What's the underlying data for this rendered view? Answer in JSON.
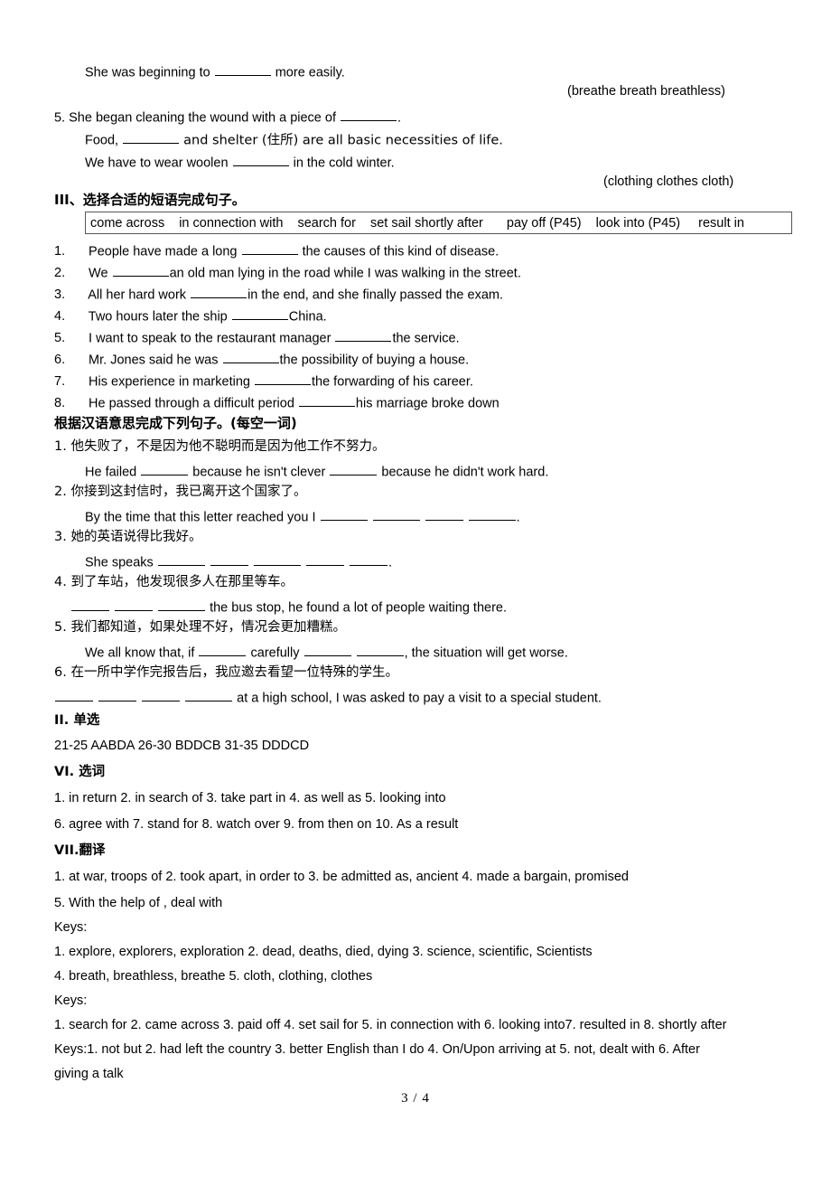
{
  "document": {
    "footer_page": "3 / 4"
  },
  "top_section": {
    "line_breathe_sentence": "She was beginning to",
    "line_breathe_tail": "more easily.",
    "word_hint_breathe": "(breathe     breath     breathless)",
    "item5_number": "5.",
    "item5_text_a": "She began cleaning the wound with a piece of",
    "item5_text_a_tail": ".",
    "item5_text_b_pre": "Food,",
    "item5_text_b_post": "and shelter (住所) are all basic necessities of life.",
    "item5_text_c_pre": "We have to wear woolen",
    "item5_text_c_post": "in the cold winter.",
    "word_hint_cloth": "(clothing   clothes   cloth)"
  },
  "section3": {
    "heading": "III、选择合适的短语完成句子。",
    "phrases": [
      "come across",
      "in connection with",
      "search for",
      "set sail shortly after",
      "pay off (P45)",
      "look into (P45)",
      "result in"
    ],
    "items": [
      {
        "num": "1.",
        "pre": "People have made a long",
        "post": "the causes of this kind of disease."
      },
      {
        "num": "2.",
        "pre": "We",
        "post": "an old man lying in the road while I was walking in the street."
      },
      {
        "num": "3.",
        "pre": "All her hard work",
        "post": "in the end, and she finally passed the exam."
      },
      {
        "num": "4.",
        "pre": "Two hours later the ship",
        "post": "China."
      },
      {
        "num": "5.",
        "pre": "I want to speak to the restaurant manager",
        "post": "the service."
      },
      {
        "num": "6.",
        "pre": "Mr. Jones said he was",
        "post": "the possibility of buying a house."
      },
      {
        "num": "7.",
        "pre": "His experience in marketing",
        "post": "the forwarding of his career."
      },
      {
        "num": "8.",
        "pre": "He passed through a difficult period",
        "post": "his marriage broke down"
      }
    ]
  },
  "translation_section": {
    "heading": "根据汉语意思完成下列句子。(每空一词)",
    "items": [
      {
        "num": "1.",
        "chinese": "他失败了，不是因为他不聪明而是因为他工作不努力。",
        "english_pre": "He failed",
        "english_mid": "because he isn't clever",
        "english_post": "because he didn't work hard."
      },
      {
        "num": "2.",
        "chinese": "你接到这封信时，我已离开这个国家了。",
        "english_pre": "By the time that this letter reached you I",
        "english_post": "."
      },
      {
        "num": "3.",
        "chinese": "她的英语说得比我好。",
        "english_pre": "She speaks",
        "english_post": "."
      },
      {
        "num": "4.",
        "chinese": "到了车站，他发现很多人在那里等车。",
        "english_post": "the bus stop, he found a lot of people waiting there."
      },
      {
        "num": "5.",
        "chinese": "我们都知道，如果处理不好，情况会更加糟糕。",
        "english_pre": "We all know that, if",
        "english_mid": "carefully",
        "english_post": ", the situation will get worse."
      },
      {
        "num": "6.",
        "chinese": "在一所中学作完报告后，我应邀去看望一位特殊的学生。",
        "english_post": "at a high school, I was asked to pay a visit to a special student."
      }
    ]
  },
  "answers": {
    "section_ii_heading": "II. 单选",
    "section_ii_line": "21-25 AABDA      26-30 BDDCB       31-35 DDDCD",
    "section_vi_heading": "VI. 选词",
    "section_vi_line1": "1. in return   2. in search of     3. take part in     4. as well as      5. looking into",
    "section_vi_line2": "6. agree with    7. stand for    8. watch over     9. from then on   10. As a result",
    "section_vii_heading": "VII.翻译",
    "section_vii_line1": "1. at war, troops of                    2. took apart, in order to 3. be admitted as, ancient         4. made a bargain, promised",
    "section_vii_line2": "5. With the help of , deal with",
    "keys1_label": "Keys:",
    "keys1_line1": "1. explore, explorers, exploration 2. dead, deaths, died, dying 3. science, scientific, Scientists",
    "keys1_line2": "4. breath, breathless, breathe 5. cloth, clothing, clothes",
    "keys2_label": "Keys:",
    "keys2_line1": "1. search for 2. came across 3. paid off 4. set sail for 5. in connection with 6. looking into7. resulted in 8. shortly after",
    "keys3_line1": "Keys:1. not but 2. had left the country 3. better English than I do 4. On/Upon arriving at 5. not, dealt with 6. After",
    "keys3_line2": "giving a talk"
  }
}
